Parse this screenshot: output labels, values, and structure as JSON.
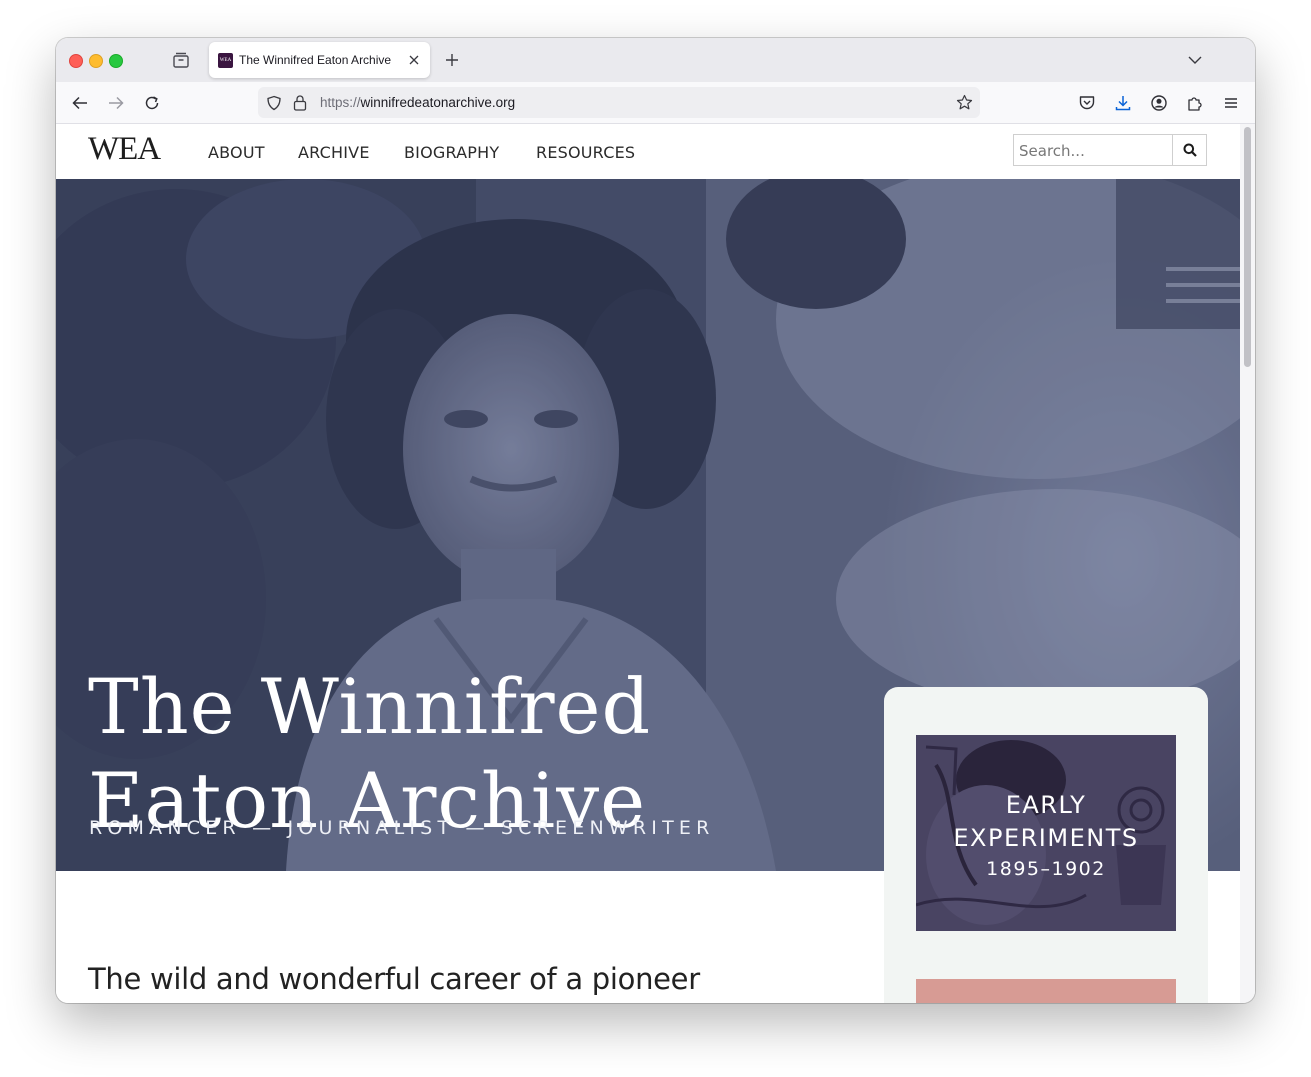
{
  "browser": {
    "tab_title": "The Winnifred Eaton Archive",
    "favicon_text": "WEA",
    "url_scheme": "https://",
    "url_host": "winnifredeatonarchive.org"
  },
  "site": {
    "logo": "WEA",
    "nav": [
      "ABOUT",
      "ARCHIVE",
      "BIOGRAPHY",
      "RESOURCES"
    ],
    "search_placeholder": "Search..."
  },
  "hero": {
    "title_line1": "The Winnifred",
    "title_line2": "Eaton Archive",
    "subtitle": "ROMANCER — JOURNALIST — SCREENWRITER"
  },
  "tagline": "The wild and wonderful career of a pioneer Asian North American writer",
  "eras": [
    {
      "title_line1": "EARLY",
      "title_line2": "EXPERIMENTS",
      "years": "1895–1902"
    }
  ],
  "colors": {
    "hero_tint": "#4f5672",
    "card_bg": "#f2f5f3",
    "era_card": "#4a4563",
    "era_card_2": "#d79b94"
  }
}
